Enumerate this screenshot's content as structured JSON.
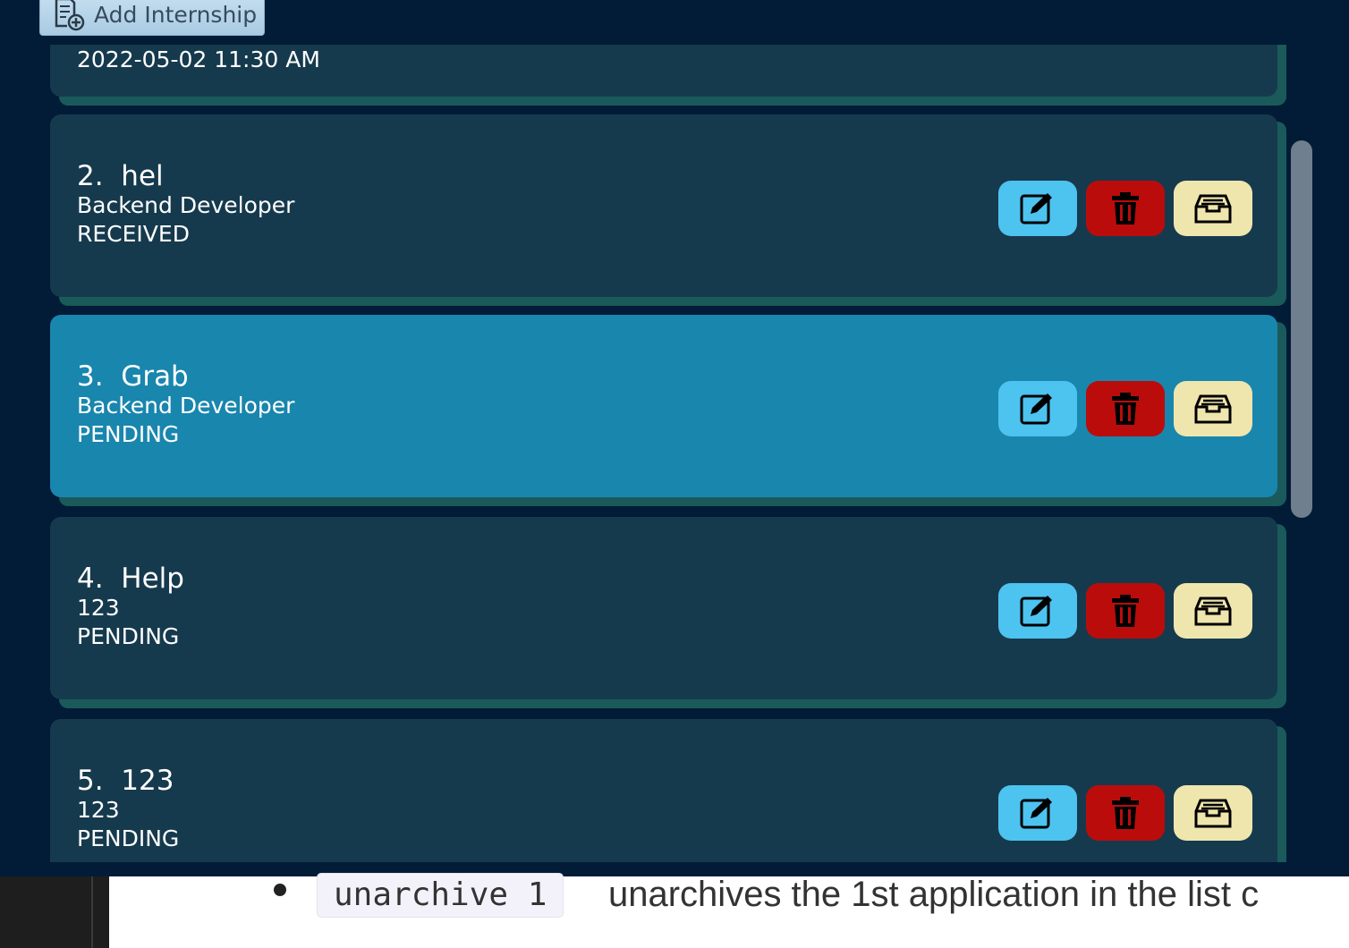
{
  "toolbar": {
    "add_label": "Add Internship"
  },
  "partial_card": {
    "date": "2022-05-02 11:30 AM"
  },
  "cards": [
    {
      "index": "2.",
      "company": "hel",
      "role": "Backend Developer",
      "status": "RECEIVED",
      "selected": false
    },
    {
      "index": "3.",
      "company": "Grab",
      "role": "Backend Developer",
      "status": "PENDING",
      "selected": true
    },
    {
      "index": "4.",
      "company": "Help",
      "role": "123",
      "status": "PENDING",
      "selected": false
    },
    {
      "index": "5.",
      "company": "123",
      "role": "123",
      "status": "PENDING",
      "selected": false
    }
  ],
  "icons": {
    "edit": "edit-icon",
    "delete": "trash-icon",
    "archive": "archive-icon"
  },
  "colors": {
    "background": "#021b37",
    "card": "#163a4d",
    "card_selected": "#1986ae",
    "edit_button": "#4dc3ef",
    "delete_button": "#bb0c0c",
    "archive_button": "#efe6ae"
  },
  "doc": {
    "code": "unarchive 1",
    "text": "unarchives the 1st application in the list c"
  }
}
